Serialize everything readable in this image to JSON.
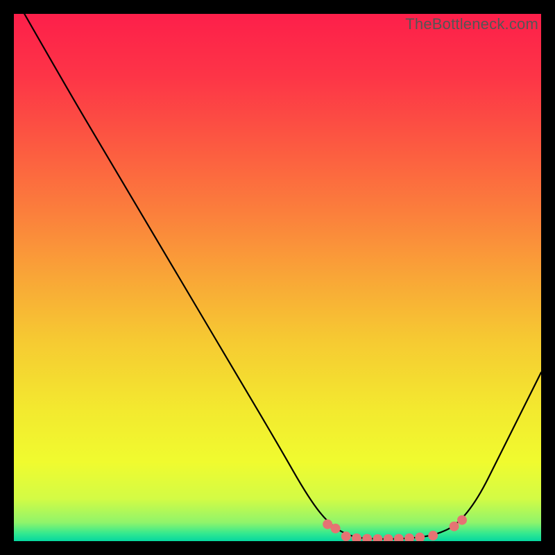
{
  "watermark": "TheBottleneck.com",
  "chart_data": {
    "type": "line",
    "title": "",
    "xlabel": "",
    "ylabel": "",
    "xlim": [
      0,
      100
    ],
    "ylim": [
      0,
      100
    ],
    "curve": {
      "name": "bottleneck-curve",
      "color": "#000000",
      "stroke_width": 2.2,
      "points": [
        {
          "x": 2.0,
          "y": 100.0
        },
        {
          "x": 10.0,
          "y": 86.0
        },
        {
          "x": 18.0,
          "y": 72.5
        },
        {
          "x": 26.0,
          "y": 59.0
        },
        {
          "x": 34.0,
          "y": 45.5
        },
        {
          "x": 42.0,
          "y": 32.0
        },
        {
          "x": 50.0,
          "y": 18.5
        },
        {
          "x": 56.0,
          "y": 8.0
        },
        {
          "x": 60.0,
          "y": 3.0
        },
        {
          "x": 64.0,
          "y": 0.8
        },
        {
          "x": 68.0,
          "y": 0.4
        },
        {
          "x": 72.0,
          "y": 0.4
        },
        {
          "x": 76.0,
          "y": 0.6
        },
        {
          "x": 80.0,
          "y": 1.2
        },
        {
          "x": 84.0,
          "y": 3.0
        },
        {
          "x": 88.0,
          "y": 8.0
        },
        {
          "x": 92.0,
          "y": 16.0
        },
        {
          "x": 96.0,
          "y": 24.0
        },
        {
          "x": 100.0,
          "y": 32.0
        }
      ]
    },
    "markers": {
      "color": "#e57373",
      "radius_px": 7,
      "points": [
        {
          "x": 59.5,
          "y": 3.2
        },
        {
          "x": 61.0,
          "y": 2.4
        },
        {
          "x": 63.0,
          "y": 0.9
        },
        {
          "x": 65.0,
          "y": 0.55
        },
        {
          "x": 67.0,
          "y": 0.45
        },
        {
          "x": 69.0,
          "y": 0.4
        },
        {
          "x": 71.0,
          "y": 0.4
        },
        {
          "x": 73.0,
          "y": 0.45
        },
        {
          "x": 75.0,
          "y": 0.55
        },
        {
          "x": 77.0,
          "y": 0.7
        },
        {
          "x": 79.5,
          "y": 1.05
        },
        {
          "x": 83.5,
          "y": 2.8
        },
        {
          "x": 85.0,
          "y": 4.0
        }
      ]
    },
    "background_gradient": {
      "stops": [
        {
          "offset": 0.0,
          "color": "#fd1f4a"
        },
        {
          "offset": 0.12,
          "color": "#fd3547"
        },
        {
          "offset": 0.25,
          "color": "#fc5a41"
        },
        {
          "offset": 0.38,
          "color": "#fb803c"
        },
        {
          "offset": 0.5,
          "color": "#f9a637"
        },
        {
          "offset": 0.62,
          "color": "#f6ca32"
        },
        {
          "offset": 0.75,
          "color": "#f3e92f"
        },
        {
          "offset": 0.85,
          "color": "#f0fb2f"
        },
        {
          "offset": 0.92,
          "color": "#d3fb45"
        },
        {
          "offset": 0.965,
          "color": "#8ff46b"
        },
        {
          "offset": 0.985,
          "color": "#35e98f"
        },
        {
          "offset": 1.0,
          "color": "#05d7a0"
        }
      ]
    }
  }
}
